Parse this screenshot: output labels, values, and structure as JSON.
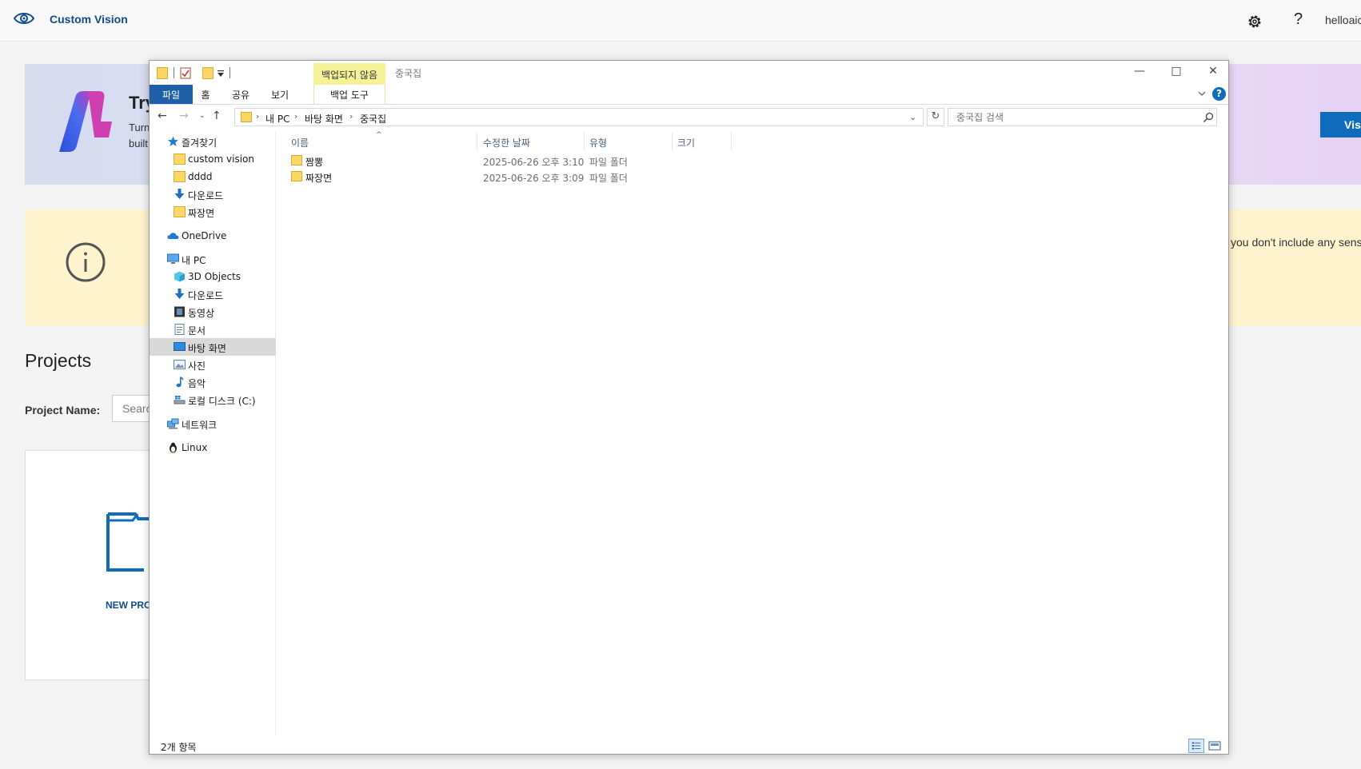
{
  "app": {
    "title": "Custom Vision",
    "user": "helloaic",
    "banner": {
      "heading": "Try",
      "line1": "Turn",
      "line2": "built",
      "visit_label": "Visi"
    },
    "info_text": "you don't include any sens",
    "projects_heading": "Projects",
    "project_name_label": "Project Name:",
    "search_placeholder": "Searc",
    "new_project_label": "NEW PRO"
  },
  "explorer": {
    "window_title": "중국집",
    "context_tab_header": "백업되지 않음",
    "ribbon_tabs": [
      "파일",
      "홈",
      "공유",
      "보기"
    ],
    "context_tab": "백업 도구",
    "breadcrumb": [
      "내 PC",
      "바탕 화면",
      "중국집"
    ],
    "search_placeholder": "중국집 검색",
    "columns": [
      "이름",
      "수정한 날짜",
      "유형",
      "크기"
    ],
    "nav": {
      "quick_access": "즐겨찾기",
      "quick_items": [
        "custom vision",
        "dddd",
        "다운로드",
        "짜장면"
      ],
      "onedrive": "OneDrive",
      "this_pc": "내 PC",
      "pc_items": [
        "3D Objects",
        "다운로드",
        "동영상",
        "문서",
        "바탕 화면",
        "사진",
        "음악",
        "로컬 디스크 (C:)"
      ],
      "network": "네트워크",
      "linux": "Linux"
    },
    "files": [
      {
        "name": "짬뽕",
        "modified": "2025-06-26 오후 3:10",
        "type": "파일 폴더"
      },
      {
        "name": "짜장면",
        "modified": "2025-06-26 오후 3:09",
        "type": "파일 폴더"
      }
    ],
    "status": "2개 항목"
  },
  "colors": {
    "accent": "#0f6cbd",
    "ribbon_file_tab": "#1f5fa8",
    "context_tab": "#f5f29a",
    "folder": "#fbd864",
    "info_bg": "#fff4ce"
  }
}
